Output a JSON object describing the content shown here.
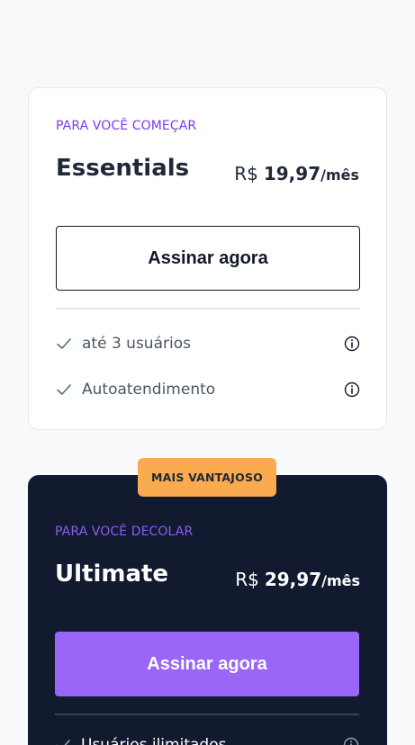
{
  "plans": [
    {
      "eyebrow": "PARA VOCÊ COMEÇAR",
      "name": "Essentials",
      "currency": "R$",
      "amount": "19,97",
      "period": "/mês",
      "cta_label": "Assinar agora",
      "features": [
        {
          "label": "até 3 usuários",
          "icon": "check-icon"
        },
        {
          "label": "Autoatendimento",
          "icon": "check-icon"
        }
      ]
    },
    {
      "badge": "MAIS VANTAJOSO",
      "eyebrow": "PARA VOCÊ DECOLAR",
      "name": "Ultimate",
      "currency": "R$",
      "amount": "29,97",
      "period": "/mês",
      "cta_label": "Assinar agora",
      "features": [
        {
          "label": "Usuários ilimitados",
          "icon": "check-icon"
        }
      ]
    }
  ],
  "colors": {
    "accent_purple": "#7c3aed",
    "cta_purple": "#9a66f5",
    "badge_orange": "#fbab4f",
    "dark_card": "#111a2e",
    "check_green": "#4b7a5e"
  }
}
